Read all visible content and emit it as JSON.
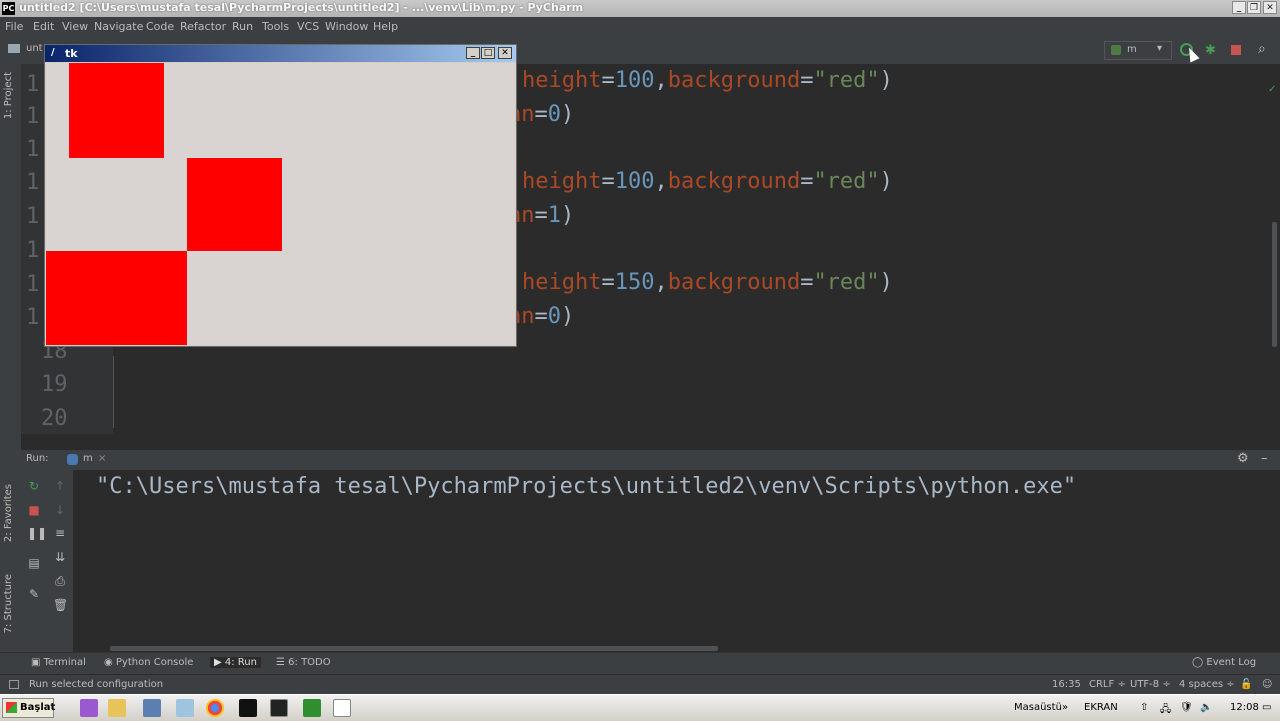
{
  "window": {
    "title": "untitled2 [C:\\Users\\mustafa tesal\\PycharmProjects\\untitled2] - ...\\venv\\Lib\\m.py - PyCharm",
    "icon": "pycharm-icon"
  },
  "menu": [
    "File",
    "Edit",
    "View",
    "Navigate",
    "Code",
    "Refactor",
    "Run",
    "Tools",
    "VCS",
    "Window",
    "Help"
  ],
  "toolbar": {
    "project_fragment": "unt",
    "run_config": "m"
  },
  "left_tabs": {
    "project": "1: Project",
    "favorites": "2: Favorites",
    "structure": "7: Structure"
  },
  "editor": {
    "gutter_numbers": [
      "1",
      "1",
      "1",
      "1",
      "1",
      "1",
      "1",
      "1",
      "18",
      "19",
      "20"
    ],
    "lines": [
      {
        "kw": "height",
        "eq": "=",
        "num": "100",
        "comma": ",",
        "bg": "background",
        "eq2": "=",
        "str": "\"red\"",
        "close": ")"
      },
      {
        "frag": "nn",
        "eq": "=",
        "num": "0",
        "close": ")"
      },
      {
        "kw": "height",
        "eq": "=",
        "num": "100",
        "comma": ",",
        "bg": "background",
        "eq2": "=",
        "str": "\"red\"",
        "close": ")"
      },
      {
        "frag": "nn",
        "eq": "=",
        "num": "1",
        "close": ")"
      },
      {
        "kw": "height",
        "eq": "=",
        "num": "150",
        "comma": ",",
        "bg": "background",
        "eq2": "=",
        "str": "\"red\"",
        "close": ")"
      },
      {
        "frag": "nn",
        "eq": "=",
        "num": "0",
        "close": ")"
      }
    ]
  },
  "tk_window": {
    "title": "tk"
  },
  "run_panel": {
    "label": "Run:",
    "tab": "m",
    "output": "\"C:\\Users\\mustafa tesal\\PycharmProjects\\untitled2\\venv\\Scripts\\python.exe\""
  },
  "tool_tabs": [
    "Terminal",
    "Python Console",
    "4: Run",
    "6: TODO"
  ],
  "event_log": "Event Log",
  "status": {
    "message": "Run selected configuration",
    "position": "16:35",
    "line_sep": "CRLF",
    "encoding": "UTF-8",
    "indent": "4 spaces"
  },
  "taskbar": {
    "start": "Başlat",
    "desktop": "Masaüstü",
    "screen": "EKRAN",
    "clock": "12:08"
  },
  "colors": {
    "accent": "#ff0000",
    "editor_bg": "#2b2b2b",
    "panel": "#3c3f41"
  }
}
